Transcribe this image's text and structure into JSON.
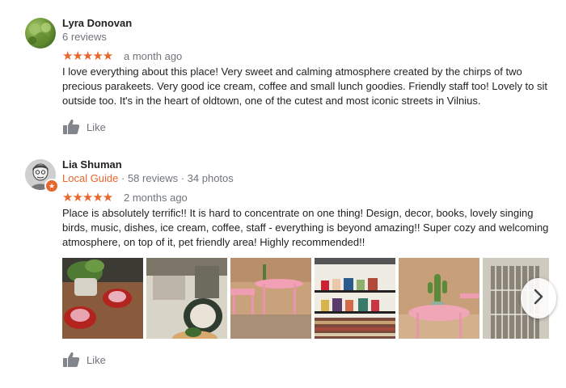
{
  "reviews": [
    {
      "author": "Lyra Donovan",
      "meta": "6 reviews",
      "rating": 5,
      "stars": "★★★★★",
      "date": "a month ago",
      "text": "I love everything about this place! Very sweet and calming atmosphere created by the chirps of two precious parakeets. Very good ice cream, coffee and small lunch goodies. Friendly staff too! Lovely to sit outside too. It's in the heart of oldtown, one of the cutest and most iconic streets in Vilnius.",
      "like_label": "Like"
    },
    {
      "author": "Lia Shuman",
      "badge": "Local Guide",
      "meta_sep": " · ",
      "review_count": "58 reviews",
      "photo_count": "34 photos",
      "rating": 5,
      "stars": "★★★★★",
      "date": "2 months ago",
      "text": "Place is absolutely terrific!! It is hard to concentrate on one thing! Design, decor, books, lovely singing birds, music, dishes, ice cream, coffee, staff - everything is beyond amazing!! Super cozy and welcoming atmosphere, on top of it, pet friendly area! Highly recommended!!",
      "like_label": "Like"
    }
  ],
  "colors": {
    "star": "#e8672d",
    "local_guide": "#e8672d",
    "muted": "#70757a"
  },
  "icons": [
    "thumbs-up-icon",
    "chevron-right-icon",
    "local-guide-star-icon"
  ]
}
